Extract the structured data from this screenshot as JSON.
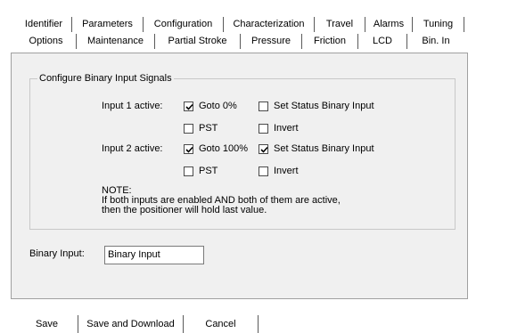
{
  "tabs_row1": [
    "Identifier",
    "Parameters",
    "Configuration",
    "Characterization",
    "Travel",
    "Alarms",
    "Tuning"
  ],
  "tabs_row2": [
    "Options",
    "Maintenance",
    "Partial Stroke",
    "Pressure",
    "Friction",
    "LCD",
    "Bin. In"
  ],
  "active_tab": "Bin. In",
  "group": {
    "title": "Configure Binary Input Signals",
    "input1_label": "Input 1 active:",
    "input2_label": "Input 2 active:",
    "input1": {
      "goto": {
        "label": "Goto 0%",
        "checked": true
      },
      "set_status": {
        "label": "Set Status Binary Input",
        "checked": false
      },
      "pst": {
        "label": "PST",
        "checked": false
      },
      "invert": {
        "label": "Invert",
        "checked": false
      }
    },
    "input2": {
      "goto": {
        "label": "Goto 100%",
        "checked": true
      },
      "set_status": {
        "label": "Set Status Binary Input",
        "checked": true
      },
      "pst": {
        "label": "PST",
        "checked": false
      },
      "invert": {
        "label": "Invert",
        "checked": false
      }
    },
    "note_title": "NOTE:",
    "note_line1": "If both inputs are enabled AND both of them are active,",
    "note_line2": "then the positioner will hold last value."
  },
  "binary_input": {
    "label": "Binary Input:",
    "value": "Binary Input"
  },
  "buttons": {
    "save": "Save",
    "save_download": "Save and Download",
    "cancel": "Cancel"
  }
}
